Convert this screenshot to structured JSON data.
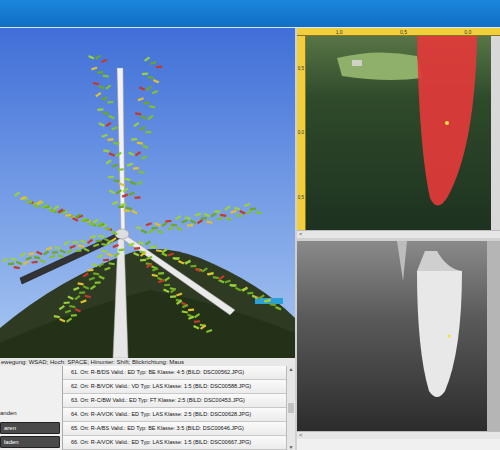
{
  "view3d": {
    "hint": "ewegung: WSAD; Hoch: SPACE; Hinunter: Shift; Blickrichtung: Maus"
  },
  "photo": {
    "ruler_top": [
      "1,0",
      "0,5",
      "0,0"
    ],
    "ruler_left": [
      "0,5",
      "0,0",
      "0,5"
    ]
  },
  "scroll_left": "<",
  "list_scroll": {
    "up": "▲",
    "down": "▼"
  },
  "side": {
    "label": "anden",
    "buttons": [
      "aren",
      "laden"
    ]
  },
  "findings": [
    {
      "text": "61. Ort: R-B/DS Valid.: ED Typ: BE Klasse: 4:5 (BILD: DSC00562.JPG)",
      "selected": false
    },
    {
      "text": "62. Ort: R-B/VOK Valid.: VD Typ: LAS Klasse: 1:5 (BILD: DSC00588.JPG)",
      "selected": false
    },
    {
      "text": "63. Ort: R-C/BW Valid.: ED Typ: FT Klasse: 2:5 (BILD: DSC00453.JPG)",
      "selected": false
    },
    {
      "text": "64. Ort: R-A/VOK Valid.: ED Typ: LAS Klasse: 2:5 (BILD: DSC00628.JPG)",
      "selected": false
    },
    {
      "text": "65. Ort: R-A/BS Valid.: ED Typ: BE Klasse: 3:5 (BILD: DSC00646.JPG)",
      "selected": false
    },
    {
      "text": "66. Ort: R-A/VOK Valid.: ED Typ: LAS Klasse: 1:5 (BILD: DSC00667.JPG)",
      "selected": false
    }
  ]
}
